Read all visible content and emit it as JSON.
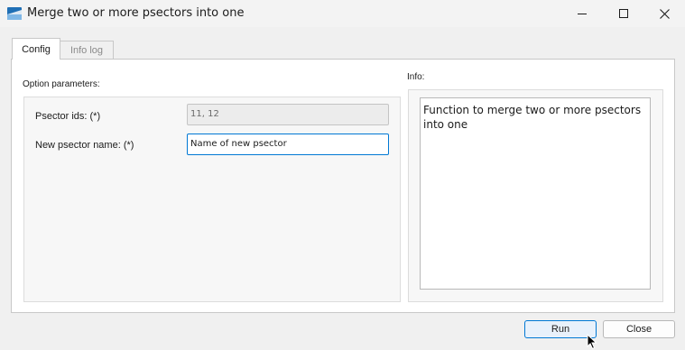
{
  "window": {
    "title": "Merge two or more psectors into one",
    "controls": [
      "minimize-icon",
      "maximize-icon",
      "close-icon"
    ]
  },
  "tabs": [
    {
      "label": "Config",
      "active": true
    },
    {
      "label": "Info log",
      "active": false
    }
  ],
  "options": {
    "section_label": "Option parameters:",
    "fields": [
      {
        "label": "Psector ids: (*)",
        "value": "11, 12",
        "enabled": false
      },
      {
        "label": "New psector name: (*)",
        "value": "Name of new psector",
        "enabled": true,
        "focused": true
      }
    ]
  },
  "info": {
    "section_label": "Info:",
    "text": "Function to merge two or more psectors into one"
  },
  "footer": {
    "run_label": "Run",
    "close_label": "Close"
  },
  "colors": {
    "accent": "#0078d4",
    "background": "#f0f0f0"
  }
}
